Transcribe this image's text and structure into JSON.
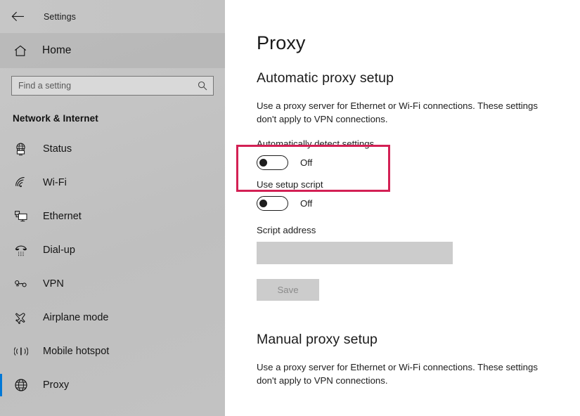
{
  "window": {
    "title": "Settings",
    "back_icon": "back-arrow-icon"
  },
  "sidebar": {
    "home": {
      "label": "Home",
      "icon": "home-icon"
    },
    "search": {
      "value": "",
      "placeholder": "Find a setting",
      "icon": "search-icon"
    },
    "category": "Network & Internet",
    "items": [
      {
        "label": "Status",
        "icon": "globe-monitor-icon",
        "selected": false
      },
      {
        "label": "Wi-Fi",
        "icon": "wifi-icon",
        "selected": false
      },
      {
        "label": "Ethernet",
        "icon": "ethernet-icon",
        "selected": false
      },
      {
        "label": "Dial-up",
        "icon": "dialup-phone-icon",
        "selected": false
      },
      {
        "label": "VPN",
        "icon": "vpn-key-icon",
        "selected": false
      },
      {
        "label": "Airplane mode",
        "icon": "airplane-icon",
        "selected": false
      },
      {
        "label": "Mobile hotspot",
        "icon": "hotspot-icon",
        "selected": false
      },
      {
        "label": "Proxy",
        "icon": "globe-icon",
        "selected": true
      }
    ]
  },
  "main": {
    "page_title": "Proxy",
    "automatic": {
      "heading": "Automatic proxy setup",
      "description": "Use a proxy server for Ethernet or Wi-Fi connections. These settings don't apply to VPN connections.",
      "auto_detect": {
        "label": "Automatically detect settings",
        "state": "Off",
        "on": false,
        "highlighted": true
      },
      "setup_script": {
        "label": "Use setup script",
        "state": "Off",
        "on": false
      },
      "script_address": {
        "label": "Script address",
        "value": "",
        "placeholder": ""
      },
      "save_label": "Save"
    },
    "manual": {
      "heading": "Manual proxy setup",
      "description": "Use a proxy server for Ethernet or Wi-Fi connections. These settings don't apply to VPN connections."
    }
  },
  "colors": {
    "accent": "#0078d7",
    "highlight_border": "#d32054",
    "sidebar_bg": "#c4c4c4",
    "disabled_bg": "#cccccc"
  }
}
